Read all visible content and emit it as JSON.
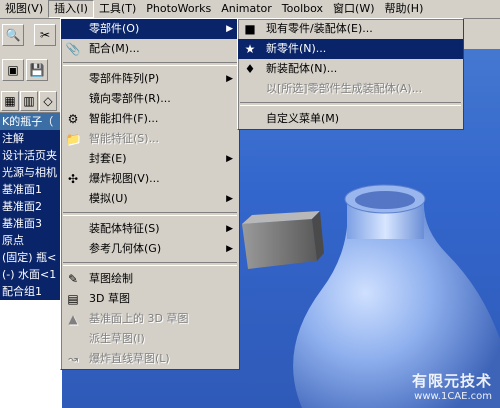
{
  "menubar": [
    {
      "label": "视图(V)",
      "state": "normal"
    },
    {
      "label": "插入(I)",
      "state": "pressed"
    },
    {
      "label": "工具(T)",
      "state": "normal"
    },
    {
      "label": "PhotoWorks",
      "state": "normal"
    },
    {
      "label": "Animator",
      "state": "normal"
    },
    {
      "label": "Toolbox",
      "state": "normal"
    },
    {
      "label": "窗口(W)",
      "state": "normal"
    },
    {
      "label": "帮助(H)",
      "state": "normal"
    }
  ],
  "tree": {
    "rows": [
      "K的瓶子（",
      "注解",
      "设计活页夹",
      "光源与相机",
      "基准面1",
      "基准面2",
      "基准面3",
      "原点",
      "(固定) 瓶<",
      "(-) 水面<1",
      "配合组1"
    ]
  },
  "insert_menu": {
    "items": [
      {
        "label": "零部件(O)",
        "icon": "",
        "arrow": true,
        "highlight": true,
        "disabled": false
      },
      {
        "label": "配合(M)...",
        "icon": "paperclip-icon",
        "arrow": false,
        "highlight": false,
        "disabled": false
      },
      {
        "sep": true
      },
      {
        "label": "零部件阵列(P)",
        "icon": "",
        "arrow": true,
        "highlight": false,
        "disabled": false
      },
      {
        "label": "镜向零部件(R)...",
        "icon": "",
        "arrow": false,
        "highlight": false,
        "disabled": false
      },
      {
        "label": "智能扣件(F)...",
        "icon": "fastener-icon",
        "arrow": false,
        "highlight": false,
        "disabled": false
      },
      {
        "label": "智能特征(S)...",
        "icon": "folder-icon",
        "arrow": false,
        "highlight": false,
        "disabled": true
      },
      {
        "label": "封套(E)",
        "icon": "",
        "arrow": true,
        "highlight": false,
        "disabled": false
      },
      {
        "label": "爆炸视图(V)...",
        "icon": "explode-icon",
        "arrow": false,
        "highlight": false,
        "disabled": false
      },
      {
        "label": "模拟(U)",
        "icon": "",
        "arrow": true,
        "highlight": false,
        "disabled": false
      },
      {
        "sep": true
      },
      {
        "label": "装配体特征(S)",
        "icon": "",
        "arrow": true,
        "highlight": false,
        "disabled": false
      },
      {
        "label": "参考几何体(G)",
        "icon": "",
        "arrow": true,
        "highlight": false,
        "disabled": false
      },
      {
        "sep": true
      },
      {
        "label": "草图绘制",
        "icon": "sketch-icon",
        "arrow": false,
        "highlight": false,
        "disabled": false
      },
      {
        "label": "3D 草图",
        "icon": "3d-sketch-icon",
        "arrow": false,
        "highlight": false,
        "disabled": false
      },
      {
        "label": "基准面上的 3D 草图",
        "icon": "plane-sketch-icon",
        "arrow": false,
        "highlight": false,
        "disabled": true
      },
      {
        "label": "派生草图(I)",
        "icon": "",
        "arrow": false,
        "highlight": false,
        "disabled": true
      },
      {
        "label": "爆炸直线草图(L)",
        "icon": "explode-line-icon",
        "arrow": false,
        "highlight": false,
        "disabled": true
      }
    ]
  },
  "sub_menu": {
    "items": [
      {
        "label": "现有零件/装配体(E)...",
        "icon": "existing-part-icon",
        "highlight": false,
        "disabled": false
      },
      {
        "label": "新零件(N)...",
        "icon": "new-part-icon",
        "highlight": true,
        "disabled": false
      },
      {
        "label": "新装配体(N)...",
        "icon": "new-assembly-icon",
        "highlight": false,
        "disabled": false
      },
      {
        "label": "以[所选]零部件生成装配体(A)...",
        "icon": "",
        "highlight": false,
        "disabled": true
      },
      {
        "sep": true
      },
      {
        "label": "自定义菜单(M)",
        "icon": "",
        "highlight": false,
        "disabled": false
      }
    ]
  },
  "watermark": {
    "cn": "有限元技术",
    "en": "www.1CAE.com"
  },
  "colors": {
    "viewport": "#3366cc",
    "menu_bg": "#d4d0c8",
    "highlight": "#0a246a"
  }
}
